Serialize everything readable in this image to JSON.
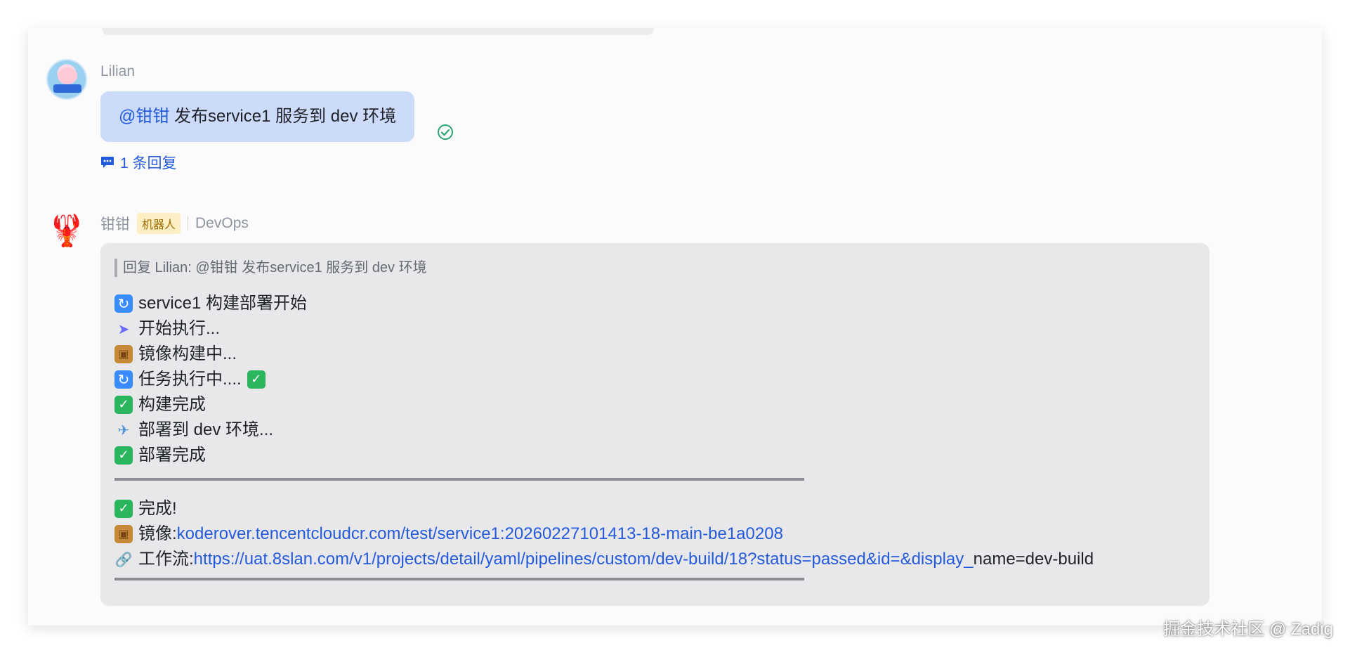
{
  "thread": {
    "message_user": {
      "sender": "Lilian",
      "mention": "@钳钳",
      "text": " 发布service1 服务到 dev 环境",
      "reply_count_label": "1 条回复"
    },
    "message_bot": {
      "sender": "钳钳",
      "badge": "机器人",
      "group": "DevOps",
      "quote": "回复 Lilian:  @钳钳 发布service1 服务到 dev 环境",
      "lines": [
        {
          "icon": "refresh-icon",
          "text": "service1 构建部署开始"
        },
        {
          "icon": "rocket-icon",
          "text": "开始执行..."
        },
        {
          "icon": "package-icon",
          "text": "镜像构建中..."
        },
        {
          "icon": "refresh-icon",
          "text": "任务执行中...."
        },
        {
          "icon": "check-icon",
          "text": "构建完成"
        },
        {
          "icon": "airplane-icon",
          "text": "部署到 dev 环境..."
        },
        {
          "icon": "check-icon",
          "text": "部署完成"
        }
      ],
      "done_text": "完成!",
      "image_label": "镜像: ",
      "image_url": "koderover.tencentcloudcr.com/test/service1:20260227101413-18-main-be1a0208",
      "workflow_label": "工作流: ",
      "workflow_url": "https://uat.8slan.com/v1/projects/detail/yaml/pipelines/custom/dev-build/18?status=passed&id=&display_",
      "workflow_url_tail": "name=dev-build"
    }
  },
  "watermark": "掘金技术社区 @ Zadig",
  "colors": {
    "accent": "#245bdb",
    "user_bubble": "#cddbfb",
    "bot_bubble": "#e8e8ea",
    "read_check": "#2ca471",
    "success": "#2bb55c"
  }
}
